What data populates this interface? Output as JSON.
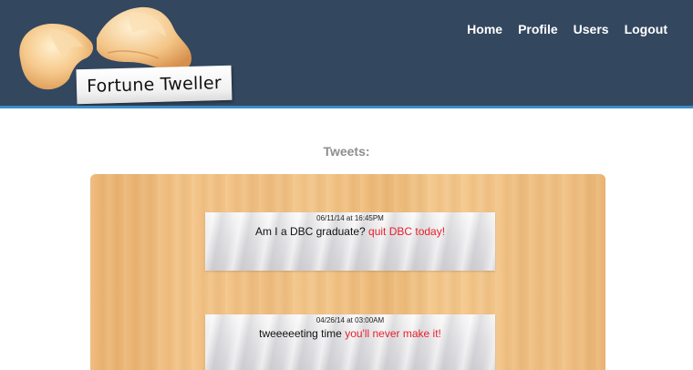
{
  "app": {
    "logo_text": "Fortune Tweller"
  },
  "nav": {
    "items": [
      {
        "label": "Home"
      },
      {
        "label": "Profile"
      },
      {
        "label": "Users"
      },
      {
        "label": "Logout"
      }
    ]
  },
  "main": {
    "section_title": "Tweets:",
    "tweets": [
      {
        "timestamp": "06/11/14 at 16:45PM",
        "text": "Am I a DBC graduate?",
        "fortune": "quit DBC today!"
      },
      {
        "timestamp": "04/26/14 at 03:00AM",
        "text": "tweeeeeting time",
        "fortune": "you'll never make it!"
      }
    ]
  },
  "colors": {
    "header_bg": "#33475f",
    "header_accent": "#3c8cc8",
    "fortune_text": "#e8202a",
    "board_wood": "#f0c080",
    "title_gray": "#8e8e8e"
  },
  "icons": {
    "logo": "fortune-cookie-icon"
  }
}
